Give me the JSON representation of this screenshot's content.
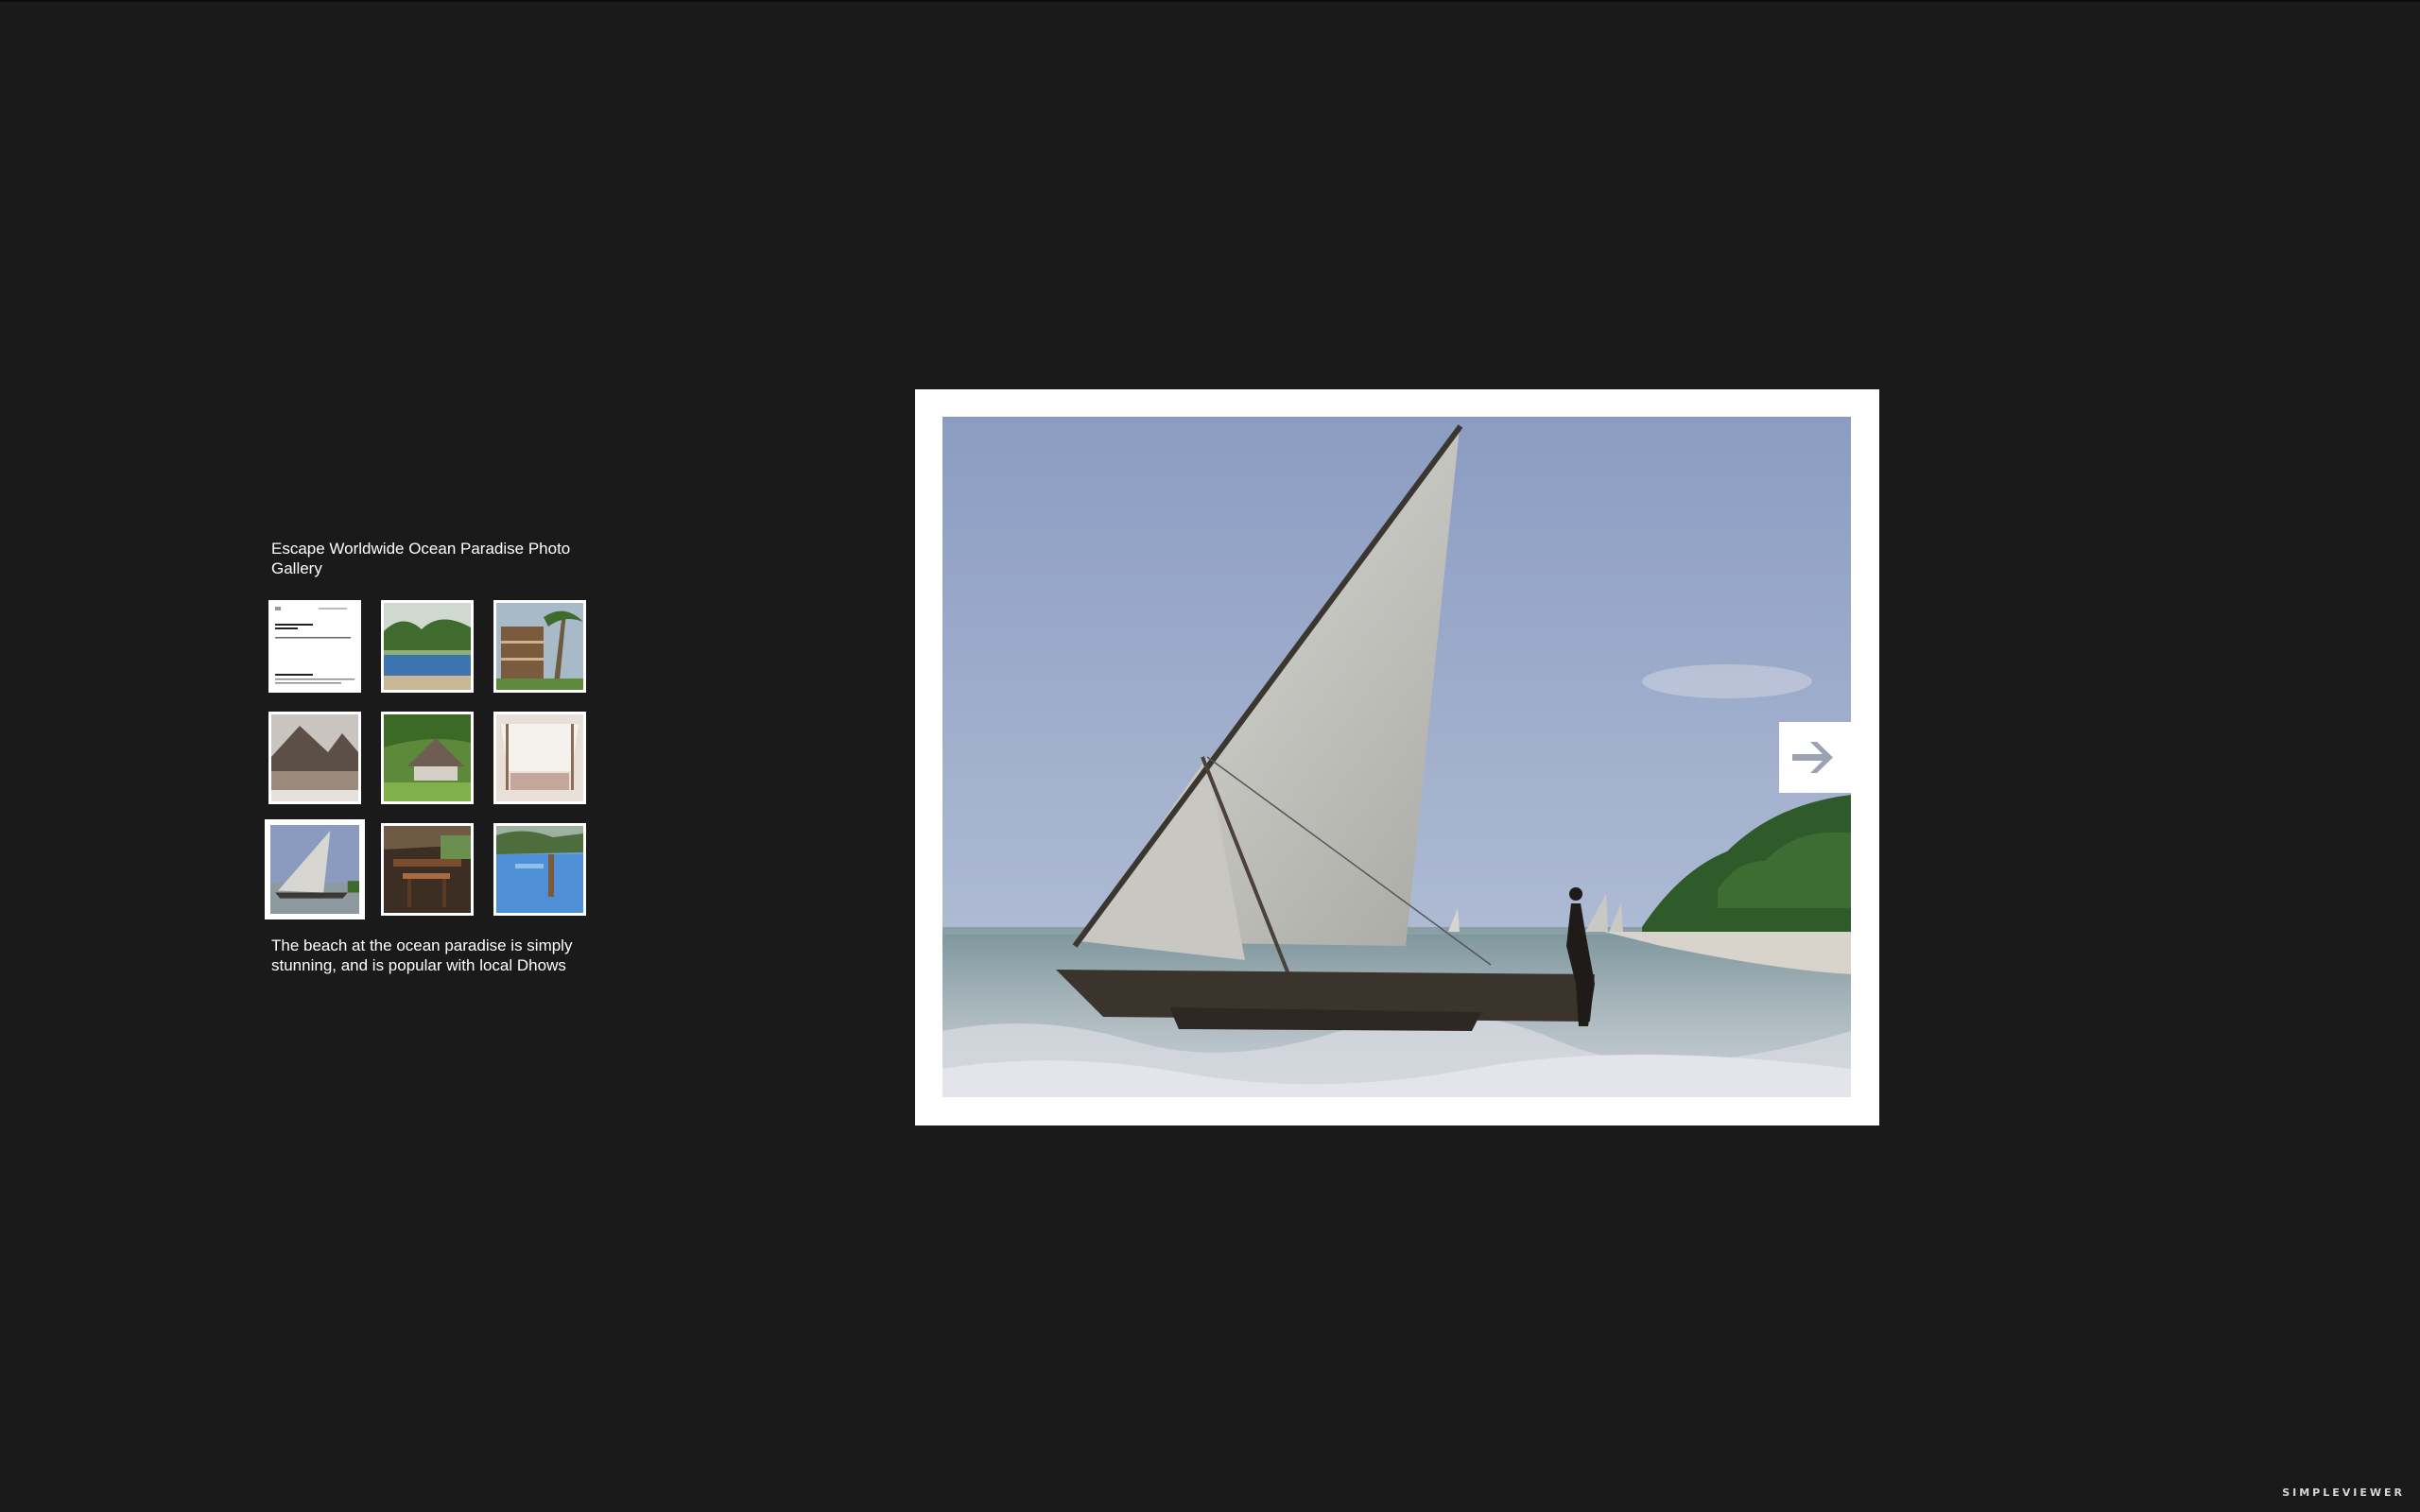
{
  "gallery": {
    "title": "Escape Worldwide Ocean Paradise Photo Gallery",
    "caption": "The beach at the ocean paradise is simply stunning, and is popular with local Dhows",
    "selected_index": 6,
    "thumbnails": [
      {
        "label": "thumbnail-brochure-page"
      },
      {
        "label": "thumbnail-pool-palms"
      },
      {
        "label": "thumbnail-hotel-palms"
      },
      {
        "label": "thumbnail-thatched-lodge"
      },
      {
        "label": "thumbnail-garden-hut"
      },
      {
        "label": "thumbnail-canopy-bed"
      },
      {
        "label": "thumbnail-dhow-beach"
      },
      {
        "label": "thumbnail-dining-deck"
      },
      {
        "label": "thumbnail-pool-jetty"
      }
    ]
  },
  "viewer": {
    "next_icon": "arrow-right-icon"
  },
  "branding": {
    "text": "SIMPLEVIEWER"
  },
  "colors": {
    "background": "#1a1a1a",
    "frame": "#ffffff",
    "arrow": "#9aa2b4"
  }
}
